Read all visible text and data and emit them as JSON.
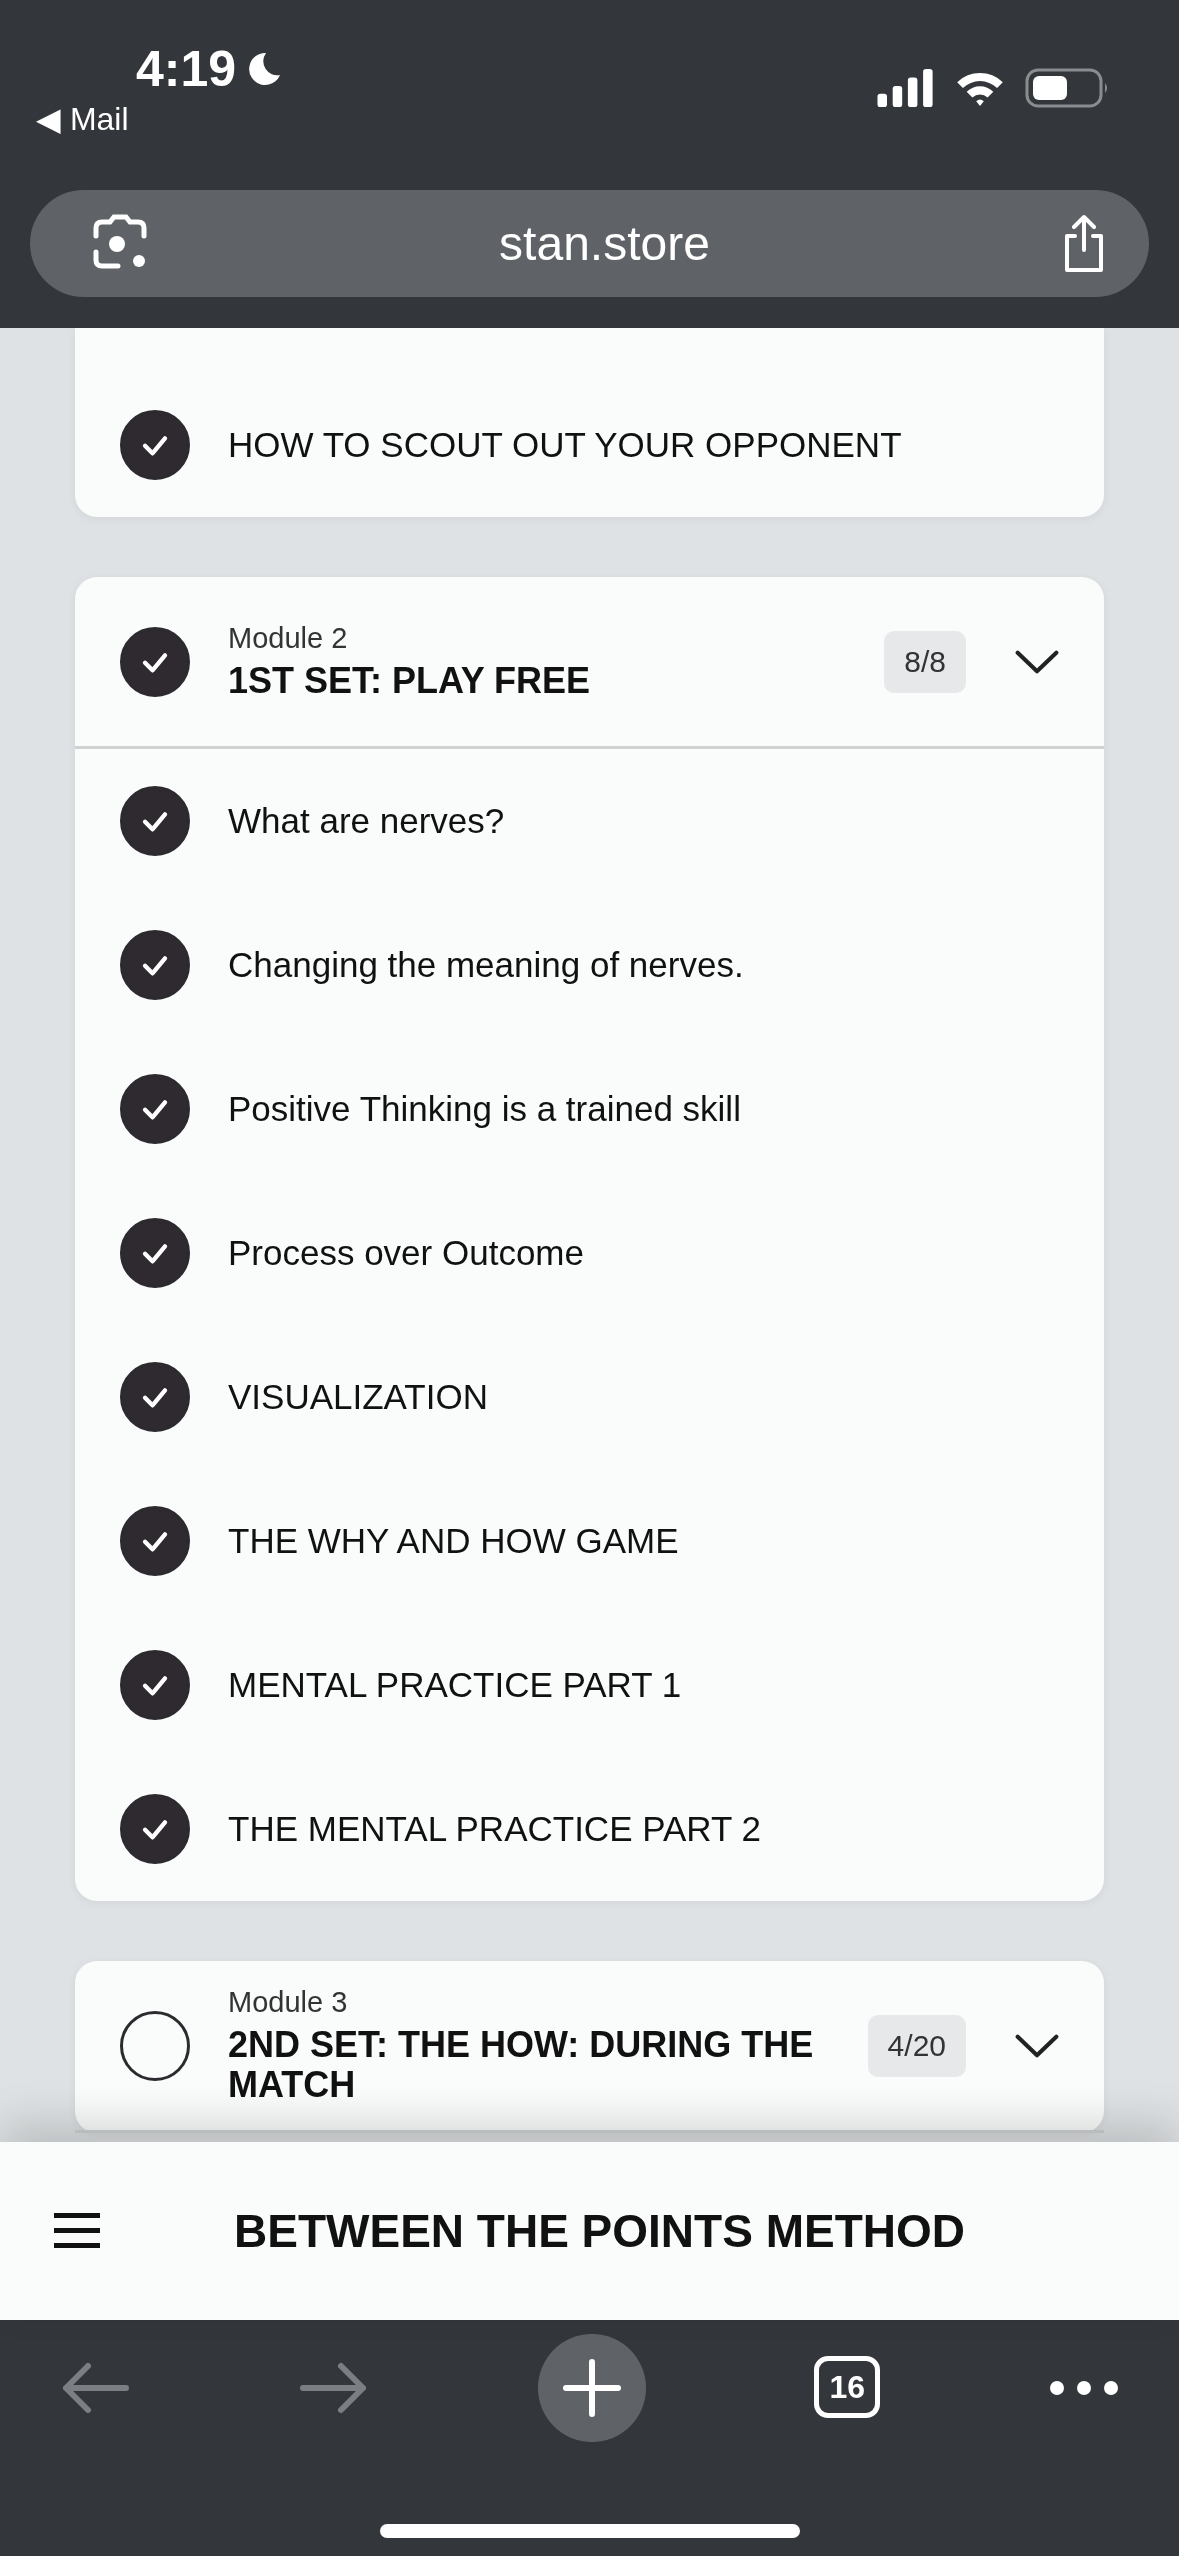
{
  "status_bar": {
    "time": "4:19",
    "back_app": "◀ Mail"
  },
  "address_bar": {
    "url": "stan.store"
  },
  "modules": [
    {
      "items": [
        {
          "title": "HOW TO SCOUT OUT YOUR OPPONENT",
          "completed": true
        }
      ]
    },
    {
      "label": "Module 2",
      "title": "1ST SET: PLAY FREE",
      "progress": "8/8",
      "completed": true,
      "items": [
        {
          "title": "What are nerves?",
          "completed": true
        },
        {
          "title": "Changing the meaning of nerves.",
          "completed": true
        },
        {
          "title": "Positive Thinking is a trained skill",
          "completed": true
        },
        {
          "title": "Process over Outcome",
          "completed": true
        },
        {
          "title": "VISUALIZATION",
          "completed": true
        },
        {
          "title": "THE WHY AND HOW GAME",
          "completed": true
        },
        {
          "title": "MENTAL PRACTICE PART 1",
          "completed": true
        },
        {
          "title": "THE MENTAL PRACTICE PART 2",
          "completed": true
        }
      ]
    },
    {
      "label": "Module 3",
      "title": "2ND SET: THE HOW: DURING THE MATCH",
      "progress": "4/20",
      "completed": false
    }
  ],
  "page_header": {
    "title": "BETWEEN THE POINTS METHOD"
  },
  "browser_toolbar": {
    "back_disabled": true,
    "forward_disabled": true,
    "tab_count": "16"
  }
}
